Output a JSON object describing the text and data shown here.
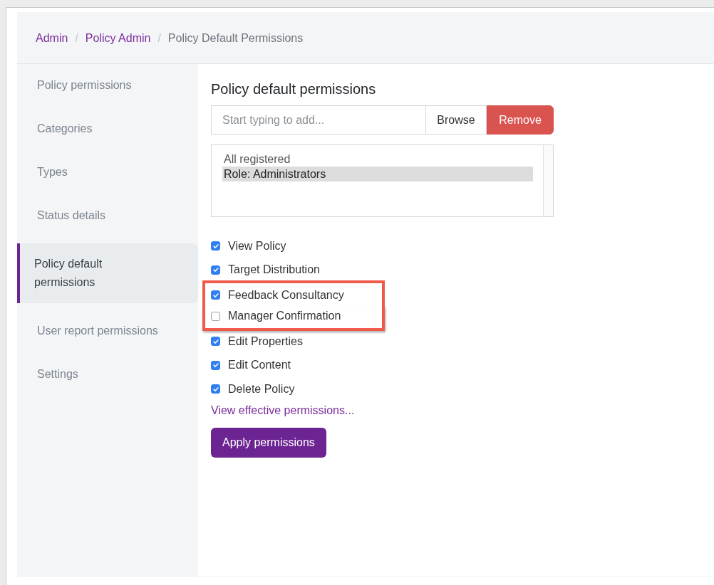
{
  "breadcrumb": {
    "separator": "/",
    "items": [
      {
        "label": "Admin",
        "kind": "link"
      },
      {
        "label": "Policy Admin",
        "kind": "link"
      },
      {
        "label": "Policy Default Permissions",
        "kind": "current"
      }
    ]
  },
  "sidebar": {
    "items": [
      {
        "label": "Policy permissions",
        "selected": false
      },
      {
        "label": "Categories",
        "selected": false
      },
      {
        "label": "Types",
        "selected": false
      },
      {
        "label": "Status details",
        "selected": false
      },
      {
        "label": "Policy default permissions",
        "selected": true
      },
      {
        "label": "User report permissions",
        "selected": false
      },
      {
        "label": "Settings",
        "selected": false
      }
    ]
  },
  "main": {
    "title": "Policy default permissions",
    "search": {
      "placeholder": "Start typing to add..."
    },
    "browse_button": "Browse",
    "remove_button": "Remove",
    "principals": [
      {
        "label": "All registered",
        "selected": false
      },
      {
        "label": "Role: Administrators",
        "selected": true
      }
    ],
    "permissions": [
      {
        "label": "View Policy",
        "checked": true,
        "highlighted": false
      },
      {
        "label": "Target Distribution",
        "checked": true,
        "highlighted": false
      },
      {
        "label": "Feedback Consultancy",
        "checked": true,
        "highlighted": true
      },
      {
        "label": "Manager Confirmation",
        "checked": false,
        "highlighted": true
      },
      {
        "label": "Edit Properties",
        "checked": true,
        "highlighted": false
      },
      {
        "label": "Edit Content",
        "checked": true,
        "highlighted": false
      },
      {
        "label": "Delete Policy",
        "checked": true,
        "highlighted": false
      }
    ],
    "effective_link": "View effective permissions...",
    "apply_button": "Apply permissions"
  }
}
